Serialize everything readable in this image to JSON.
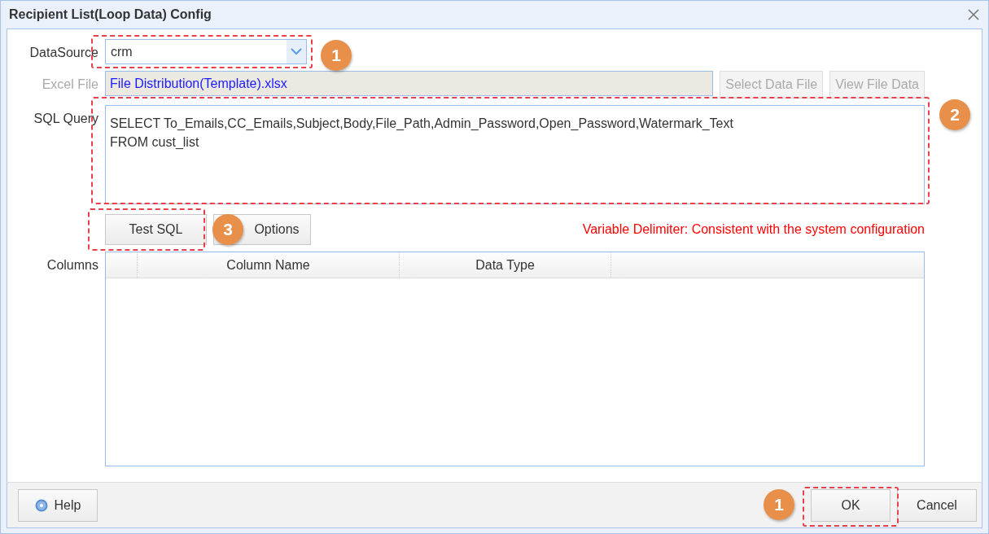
{
  "window": {
    "title": "Recipient List(Loop Data) Config"
  },
  "form": {
    "datasource": {
      "label": "DataSource",
      "value": "crm"
    },
    "excel_file": {
      "label": "Excel File",
      "value": "File Distribution(Template).xlsx",
      "disabled": true
    },
    "file_buttons": [
      {
        "label": "Select Data File",
        "disabled": true
      },
      {
        "label": "View File Data",
        "disabled": true
      }
    ],
    "sql_query": {
      "label": "SQL Query",
      "lines": [
        "SELECT To_Emails,CC_Emails,Subject,Body,File_Path,Admin_Password,Open_Password,Watermark_Text",
        "FROM cust_list"
      ]
    },
    "query_buttons": [
      {
        "label": "Test SQL",
        "disabled": false
      },
      {
        "label": "Options",
        "disabled": false
      }
    ],
    "delimiter_note": "Variable Delimiter: Consistent with the system configuration",
    "columns": {
      "label": "Columns",
      "headers": [
        "Column Name",
        "Data Type"
      ]
    }
  },
  "footer": {
    "help": "Help",
    "buttons": [
      "OK",
      "Cancel"
    ]
  },
  "annotations": [
    {
      "number": "1"
    },
    {
      "number": "2"
    },
    {
      "number": "3"
    },
    {
      "number": "1"
    }
  ]
}
